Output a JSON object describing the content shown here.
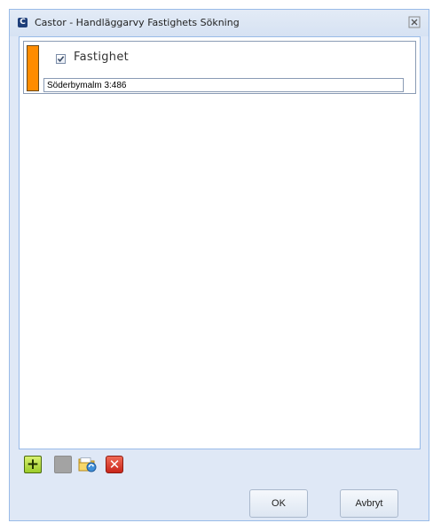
{
  "window": {
    "title": "Castor - Handläggarvy Fastighets Sökning",
    "app_icon_letter": "C"
  },
  "criteria": [
    {
      "checked": true,
      "label": "Fastighet",
      "value": "Söderbymalm 3:486"
    }
  ],
  "toolbar": {
    "add_glyph": "+",
    "remove_glyph": "✕"
  },
  "buttons": {
    "ok_label": "OK",
    "cancel_label": "Avbryt"
  },
  "colors": {
    "criteria_marker": "#ff8c00",
    "window_background": "#dfe8f6"
  }
}
